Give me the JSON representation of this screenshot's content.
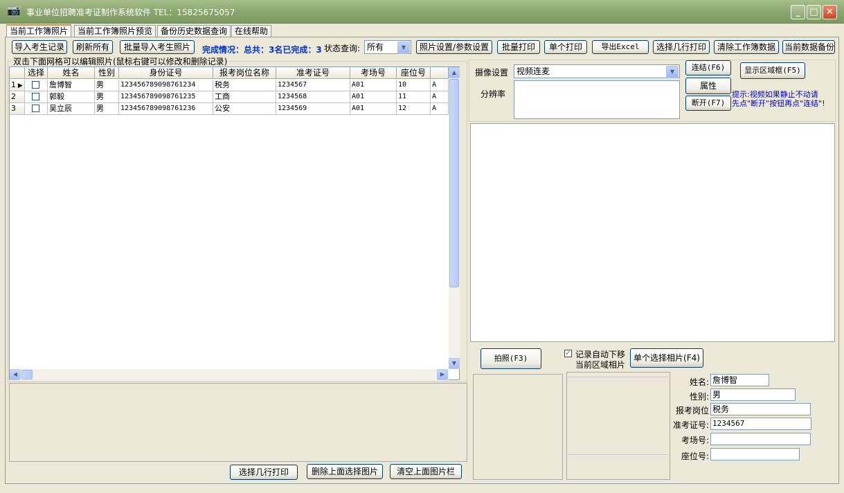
{
  "window": {
    "title": "事业单位招聘准考证制作系统软件 TEL：15825675057",
    "icon": "camera-icon"
  },
  "tabs": [
    {
      "label": "当前工作簿照片"
    },
    {
      "label": "当前工作簿照片预览"
    },
    {
      "label": "备份历史数据查询"
    },
    {
      "label": "在线帮助"
    }
  ],
  "toolbar": {
    "import_records": "导入考生记录",
    "refresh_all": "刷新所有",
    "batch_import_photos": "批量导入考生照片",
    "completion_text": "完成情况：总共：3名已完成：3",
    "status_query_label": "状态查询:",
    "status_query_value": "所有",
    "photo_settings": "照片设置/参数设置",
    "batch_print": "批量打印",
    "single_print": "单个打印",
    "export_excel": "导出Excel",
    "select_rows_print": "选择几行打印",
    "clear_workbook": "清除工作簿数据",
    "backup_current": "当前数据备份"
  },
  "grid": {
    "caption": "双击下面网格可以编辑照片(鼠标右键可以修改和删除记录)",
    "columns": [
      "选择",
      "姓名",
      "性别",
      "身份证号",
      "报考岗位名称",
      "准考证号",
      "考场号",
      "座位号"
    ],
    "rows": [
      {
        "idx": "1",
        "name": "詹博智",
        "gender": "男",
        "id": "123456789098761234",
        "post": "税务",
        "ticket": "1234567",
        "room": "A01",
        "seat": "10",
        "extra": "A"
      },
      {
        "idx": "2",
        "name": "郭毅",
        "gender": "男",
        "id": "123456789098761235",
        "post": "工商",
        "ticket": "1234568",
        "room": "A01",
        "seat": "11",
        "extra": "A"
      },
      {
        "idx": "3",
        "name": "吴立辰",
        "gender": "男",
        "id": "123456789098761236",
        "post": "公安",
        "ticket": "1234569",
        "room": "A01",
        "seat": "12",
        "extra": "A"
      }
    ]
  },
  "bottom_left": {
    "select_rows_print": "选择几行打印",
    "delete_selected_images": "删除上面选择图片",
    "clear_image_bar": "清空上面图片栏"
  },
  "camera": {
    "settings_label": "摄像设置",
    "device_value": "视频连麦",
    "resolution_label": "分辨率",
    "connect": "连结(F6)",
    "properties": "属性",
    "disconnect": "断开(F7)",
    "show_area": "显示区域框(F5)",
    "hint_line1": "提示:视频如果静止不动请",
    "hint_line2": "先点\"断开\"按钮再点\"连结\"!"
  },
  "capture": {
    "take_photo": "拍照(F3)",
    "auto_move_label": "记录自动下移",
    "current_area_label": "当前区域相片",
    "single_select_photo": "单个选择相片(F4)"
  },
  "record_form": {
    "name_label": "姓名:",
    "name_value": "詹博智",
    "gender_label": "性别:",
    "gender_value": "男",
    "post_label": "报考岗位",
    "post_value": "税务",
    "ticket_label": "准考证号:",
    "ticket_value": "1234567",
    "room_label": "考场号:",
    "room_value": "",
    "seat_label": "座位号:",
    "seat_value": ""
  },
  "colors": {
    "titlebar": "#8aa66e",
    "completion_text": "#0033cc",
    "hint_text": "#0000cc",
    "tab_active_accent": "#e68b2c"
  }
}
